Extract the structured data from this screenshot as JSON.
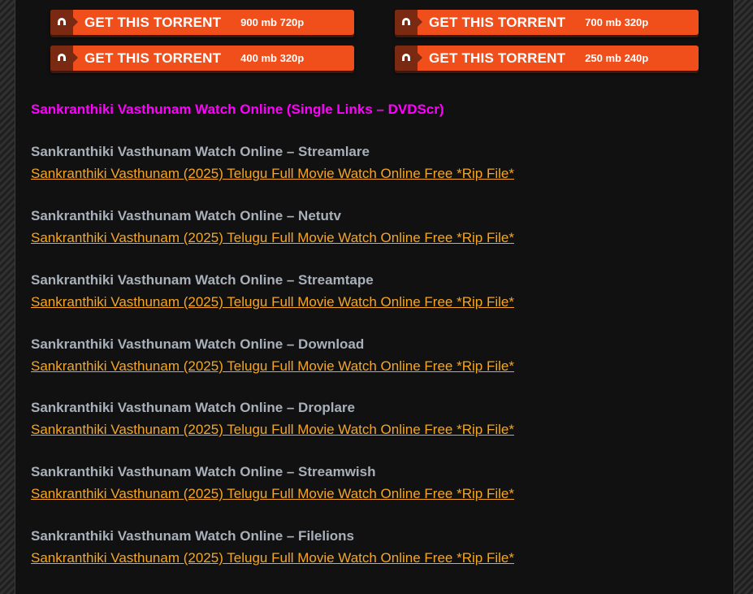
{
  "torrent_buttons": [
    {
      "label": "GET THIS TORRENT",
      "size": "900 mb 720p"
    },
    {
      "label": "GET THIS TORRENT",
      "size": "700 mb 320p"
    },
    {
      "label": "GET THIS TORRENT",
      "size": "400 mb 320p"
    },
    {
      "label": "GET THIS TORRENT",
      "size": "250 mb 240p"
    }
  ],
  "section_heading": "Sankranthiki Vasthunam Watch Online (Single Links – DVDScr)",
  "streams": [
    {
      "title": "Sankranthiki Vasthunam Watch Online – Streamlare",
      "link": "Sankranthiki Vasthunam (2025) Telugu Full Movie Watch Online Free *Rip File*"
    },
    {
      "title": "Sankranthiki Vasthunam Watch Online – Netutv",
      "link": "Sankranthiki Vasthunam (2025) Telugu Full Movie Watch Online Free *Rip File*"
    },
    {
      "title": "Sankranthiki Vasthunam Watch Online – Streamtape",
      "link": "Sankranthiki Vasthunam (2025) Telugu Full Movie Watch Online Free *Rip File*"
    },
    {
      "title": "Sankranthiki Vasthunam Watch Online – Download",
      "link": "Sankranthiki Vasthunam (2025) Telugu Full Movie Watch Online Free *Rip File*"
    },
    {
      "title": "Sankranthiki Vasthunam Watch Online – Droplare",
      "link": "Sankranthiki Vasthunam (2025) Telugu Full Movie Watch Online Free *Rip File*"
    },
    {
      "title": "Sankranthiki Vasthunam Watch Online – Streamwish",
      "link": "Sankranthiki Vasthunam (2025) Telugu Full Movie Watch Online Free *Rip File*"
    },
    {
      "title": "Sankranthiki Vasthunam Watch Online – Filelions",
      "link": "Sankranthiki Vasthunam (2025) Telugu Full Movie Watch Online Free *Rip File*"
    }
  ],
  "colors": {
    "page_bg": "#111111",
    "button_orange": "#f04e1a",
    "heading_magenta": "#ff00ff",
    "title_gray": "#a9b0ba",
    "link_orange": "#f5a623"
  },
  "icons": {
    "torrent_button": "magnet-icon"
  }
}
